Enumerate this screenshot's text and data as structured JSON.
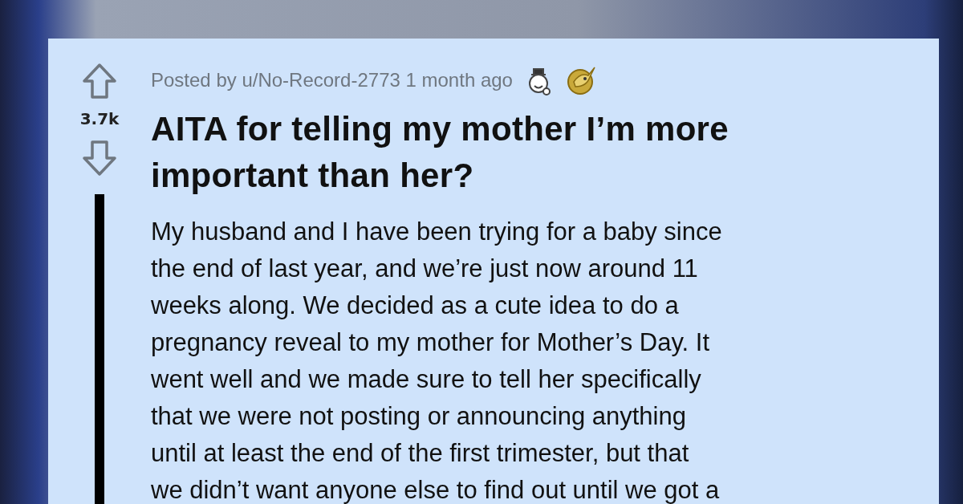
{
  "post": {
    "score": "3.7k",
    "meta": "Posted by u/No-Record-2773 1 month ago",
    "title": "AITA for telling my mother I’m more important than her?",
    "body_lines": [
      "My husband and I have been trying for a baby since",
      "the end of last year, and we’re just now around 11",
      "weeks along. We decided as a cute idea to do a",
      "pregnancy reveal to my mother for Mother’s Day. It",
      "went well and we made sure to tell her specifically",
      "that we were not posting or announcing anything",
      "until at least the end of the first trimester, but that",
      "we didn’t want anyone else to find out until we got a"
    ]
  }
}
